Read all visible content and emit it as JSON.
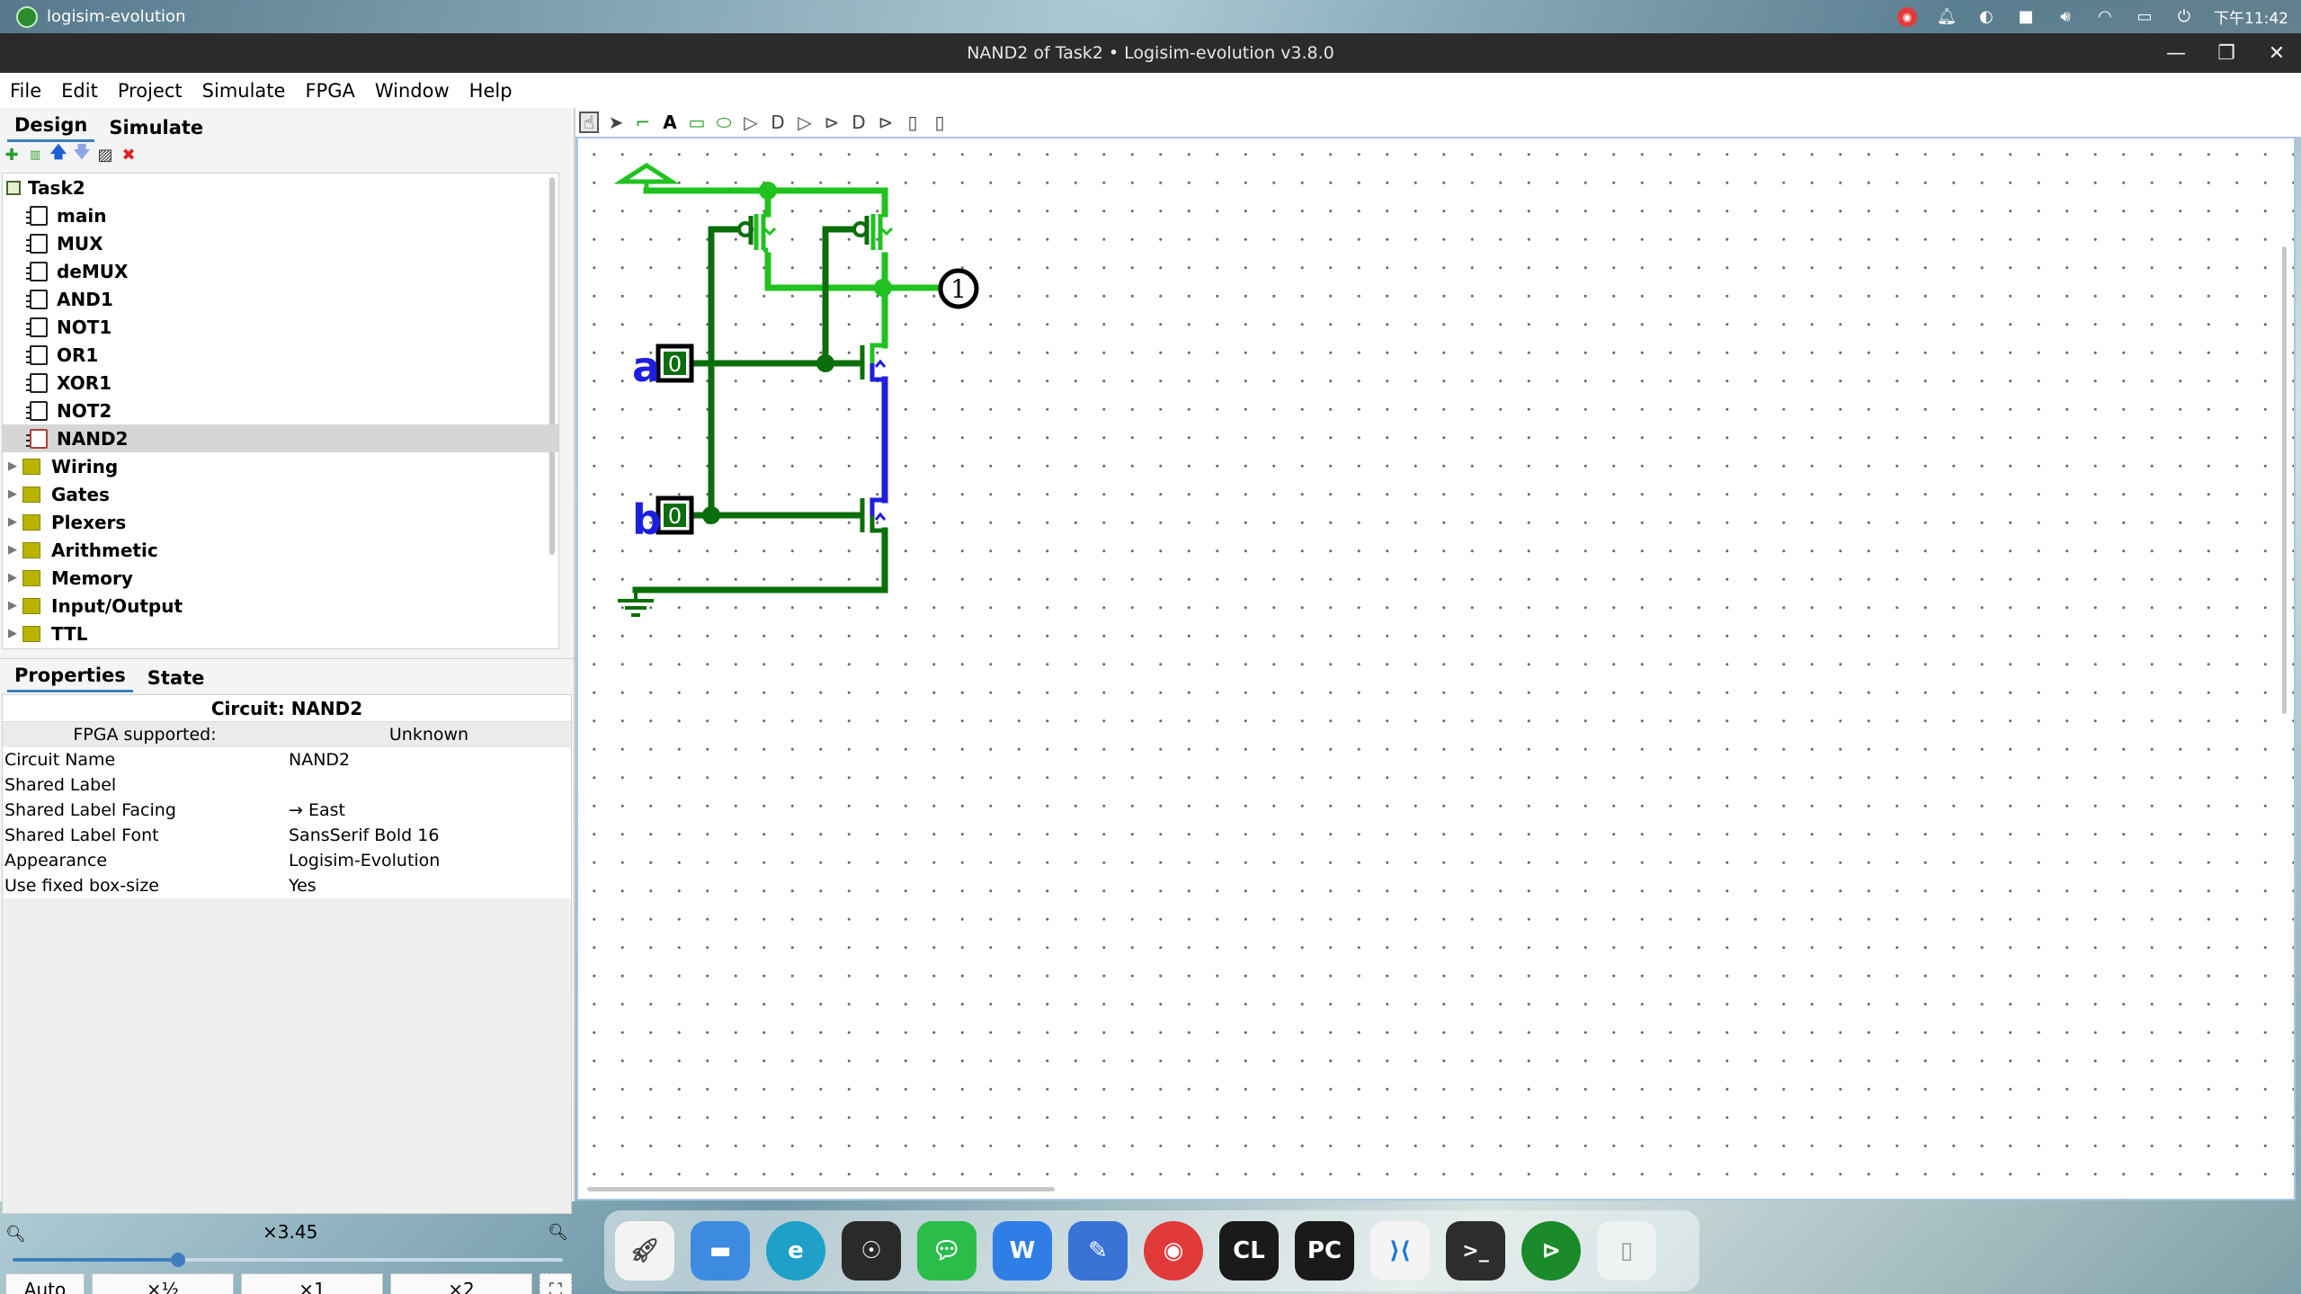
{
  "system_bar": {
    "app_name": "logisim-evolution",
    "clock": "下午11:42",
    "tray_icons": [
      "netease-music-icon",
      "bell-icon",
      "d-icon",
      "square-icon",
      "volume-icon",
      "wifi-icon",
      "battery-icon",
      "power-icon"
    ]
  },
  "window": {
    "title": "NAND2 of Task2 • Logisim-evolution v3.8.0",
    "minimize": "—",
    "restore": "❐",
    "close": "✕"
  },
  "menu": [
    "File",
    "Edit",
    "Project",
    "Simulate",
    "FPGA",
    "Window",
    "Help"
  ],
  "left_tabs": [
    "Design",
    "Simulate"
  ],
  "project_toolbar_icons": [
    "add-circuit-icon",
    "add-vhdl-icon",
    "move-up-icon",
    "move-down-icon",
    "edit-appearance-icon",
    "delete-icon"
  ],
  "tree": {
    "root": "Task2",
    "circuits": [
      "main",
      "MUX",
      "deMUX",
      "AND1",
      "NOT1",
      "OR1",
      "XOR1",
      "NOT2",
      "NAND2"
    ],
    "selected": "NAND2",
    "libraries": [
      "Wiring",
      "Gates",
      "Plexers",
      "Arithmetic",
      "Memory",
      "Input/Output",
      "TTL"
    ]
  },
  "prop_tabs": [
    "Properties",
    "State"
  ],
  "properties": {
    "title": "Circuit: NAND2",
    "head": [
      "FPGA supported:",
      "Unknown"
    ],
    "rows": [
      [
        "Circuit Name",
        "NAND2"
      ],
      [
        "Shared Label",
        ""
      ],
      [
        "Shared Label Facing",
        "→ East"
      ],
      [
        "Shared Label Font",
        "SansSerif Bold 16"
      ],
      [
        "Appearance",
        "Logisim-Evolution"
      ],
      [
        "Use fixed box-size",
        "Yes"
      ]
    ]
  },
  "zoom": {
    "label": "×3.45",
    "level_fraction": 0.3,
    "buttons": [
      "Auto",
      "×½",
      "×1",
      "×2"
    ]
  },
  "canvas_toolbar_icons": [
    "poke-tool-icon",
    "select-tool-icon",
    "wire-tool-icon",
    "text-tool-icon",
    "pin-input-icon",
    "pin-output-icon",
    "not-gate-icon",
    "and-gate-icon",
    "buffer-icon",
    "or-gate-icon",
    "nand-gate-icon",
    "xor-gate-icon",
    "appearance-a-icon",
    "appearance-b-icon"
  ],
  "circuit": {
    "input_a_label": "a",
    "input_a_value": "0",
    "input_b_label": "b",
    "input_b_value": "0",
    "output_value": "1",
    "colors": {
      "high_wire": "#1fc21f",
      "low_wire": "#0a6e0a",
      "float_wire": "#1e1ee0",
      "label": "#1e1ee0"
    }
  },
  "dock_icons": [
    "launchpad-icon",
    "files-icon",
    "edge-icon",
    "ai-assistant-icon",
    "wechat-icon",
    "wps-icon",
    "notes-icon",
    "netease-music-icon",
    "clion-icon",
    "pycharm-icon",
    "vscode-icon",
    "terminal-icon",
    "logisim-icon",
    "trash-icon"
  ],
  "dock_text": {
    "clion": "CL",
    "pycharm": "PC",
    "terminal": ">_"
  }
}
